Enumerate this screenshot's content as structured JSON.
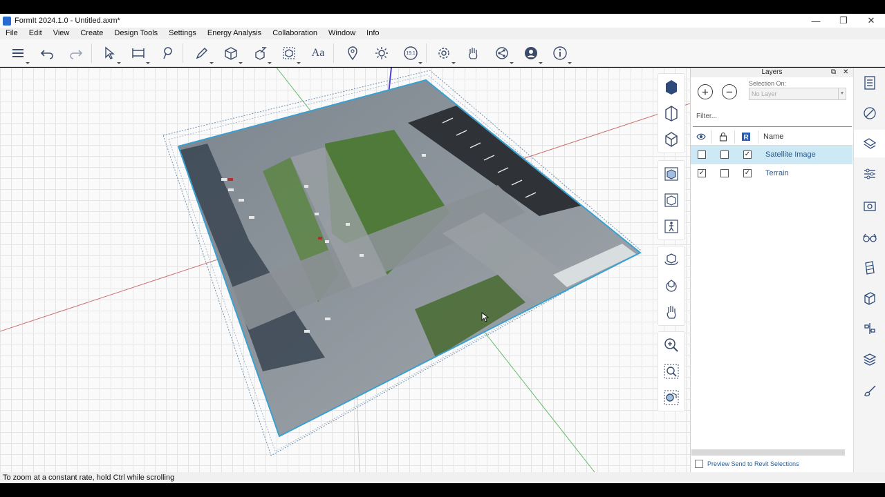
{
  "window": {
    "title": "FormIt 2024.1.0 - Untitled.axm*",
    "minimize": "—",
    "restore": "❐",
    "close": "✕"
  },
  "menu": [
    "File",
    "Edit",
    "View",
    "Create",
    "Design Tools",
    "Settings",
    "Energy Analysis",
    "Collaboration",
    "Window",
    "Info"
  ],
  "toolbar": {
    "text_tool_label": "Aa",
    "level_badge": "19.1"
  },
  "layers_panel": {
    "title": "Layers",
    "add_symbol": "+",
    "remove_symbol": "−",
    "selection_label": "Selection On:",
    "selection_value": "No Layer",
    "filter_placeholder": "Filter...",
    "name_header": "Name",
    "rows": [
      {
        "name": "Satellite Image",
        "visible": false,
        "locked": false,
        "send_to_revit": true,
        "selected": true
      },
      {
        "name": "Terrain",
        "visible": true,
        "locked": false,
        "send_to_revit": true,
        "selected": false
      }
    ],
    "preview_label": "Preview Send to Revit Selections"
  },
  "status_bar": {
    "message": "To zoom at a constant rate, hold Ctrl while scrolling"
  },
  "colors": {
    "accent": "#3aa0d0",
    "selected_row": "#cde9f5",
    "axis_x": "#c0504d",
    "axis_y": "#4caf50",
    "axis_z": "#4b3fd0"
  }
}
